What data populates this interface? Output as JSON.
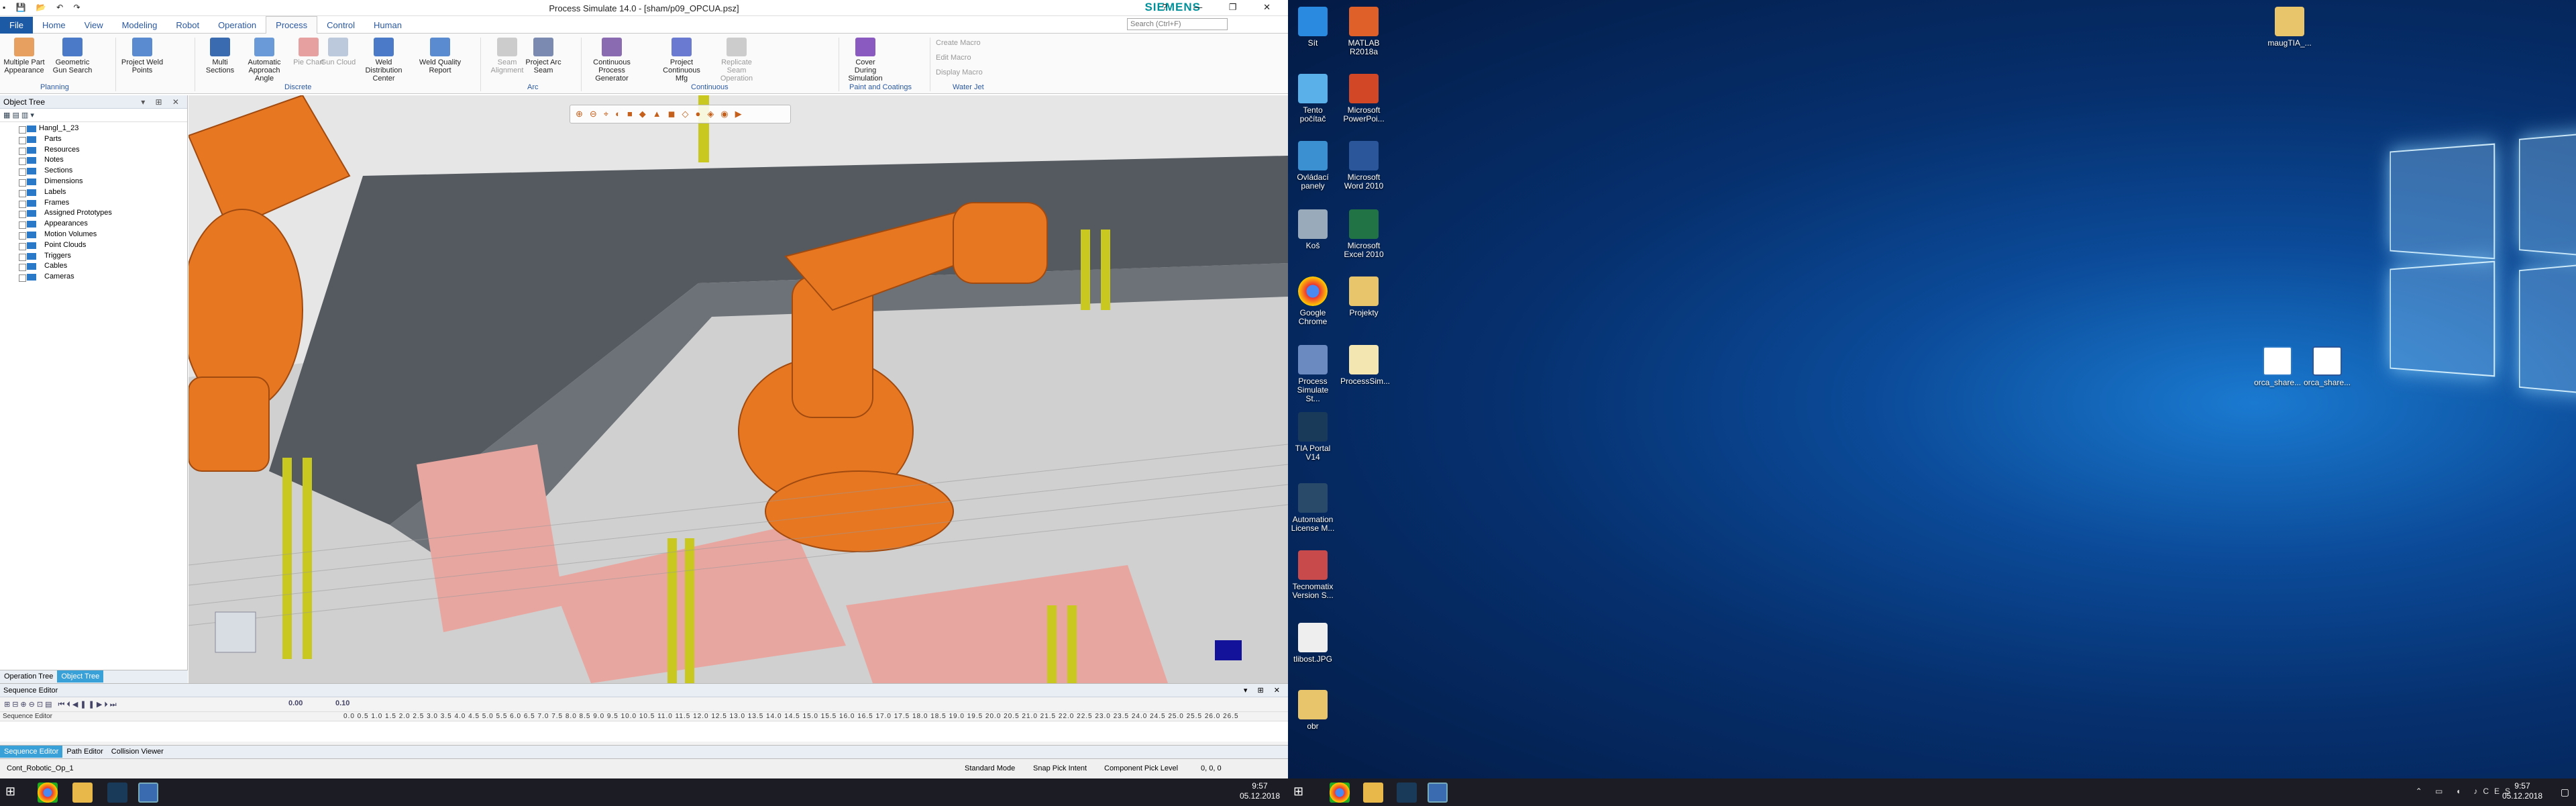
{
  "app": {
    "window_title": "Process Simulate 14.0 - [sham/p09_OPCUA.psz]",
    "brand": "SIEMENS",
    "search_placeholder": "Search (Ctrl+F)",
    "tabs": [
      "File",
      "Home",
      "View",
      "Modeling",
      "Robot",
      "Operation",
      "Process",
      "Control",
      "Human"
    ],
    "active_tab": "Process"
  },
  "ribbon": {
    "buttons": [
      {
        "label": "Multiple Part Appearance",
        "disabled": false
      },
      {
        "label": "Geometric Gun Search",
        "disabled": false
      },
      {
        "label": "Project Weld Points",
        "disabled": false
      },
      {
        "label": "Multi Sections",
        "disabled": false
      },
      {
        "label": "Automatic Approach Angle",
        "disabled": false
      },
      {
        "label": "Pie Chart",
        "disabled": true
      },
      {
        "label": "Gun Cloud",
        "disabled": true
      },
      {
        "label": "Weld Distribution Center",
        "disabled": false
      },
      {
        "label": "Weld Quality Report",
        "disabled": false
      },
      {
        "label": "Seam Alignment",
        "disabled": true
      },
      {
        "label": "Project Arc Seam",
        "disabled": false
      },
      {
        "label": "Continuous Process Generator",
        "disabled": false
      },
      {
        "label": "Project Continuous Mfg",
        "disabled": false
      },
      {
        "label": "Replicate Seam Operation",
        "disabled": true
      },
      {
        "label": "Cover During Simulation",
        "disabled": false
      }
    ],
    "groups": [
      "Planning",
      "Discrete",
      "Arc",
      "Continuous",
      "Paint and Coatings",
      "Water Jet"
    ],
    "macros": [
      "Create Macro",
      "Edit Macro",
      "Display Macro"
    ]
  },
  "object_tree": {
    "title": "Object Tree",
    "root": "Hangl_1_23",
    "items": [
      "Parts",
      "Resources",
      "Notes",
      "Sections",
      "Dimensions",
      "Labels",
      "Frames",
      "Assigned Prototypes",
      "Appearances",
      "Motion Volumes",
      "Point Clouds",
      "Triggers",
      "Cables",
      "Cameras"
    ],
    "tabs": [
      "Operation Tree",
      "Object Tree"
    ]
  },
  "sequence_editor": {
    "title": "Sequence Editor",
    "time_value": "0.00",
    "step_value": "0.10",
    "row_label": "Sequence Editor",
    "ruler_ticks": "0.0 0.5 1.0 1.5 2.0 2.5 3.0 3.5 4.0 4.5 5.0 5.5 6.0 6.5 7.0 7.5 8.0 8.5 9.0 9.5 10.0 10.5 11.0 11.5 12.0 12.5 13.0 13.5 14.0 14.5 15.0 15.5 16.0 16.5 17.0 17.5 18.0 18.5 19.0 19.5 20.0 20.5 21.0 21.5 22.0 22.5 23.0 23.5 24.0 24.5 25.0 25.5 26.0 26.5",
    "tabs": [
      "Sequence Editor",
      "Path Editor",
      "Collision Viewer"
    ]
  },
  "status_bar": {
    "operation": "Cont_Robotic_Op_1",
    "mode": "Standard Mode",
    "pick_intent": "Snap Pick Intent",
    "pick_level": "Component Pick Level",
    "coords": "0, 0, 0"
  },
  "taskbar": {
    "time": "9:57",
    "date": "05.12.2018",
    "lang": "CES"
  },
  "desktop_icons": [
    "Sít",
    "MATLAB R2018a",
    "Tento počítač",
    "Microsoft PowerPoi...",
    "Ovládací panely",
    "Microsoft Word 2010",
    "Koš",
    "Microsoft Excel 2010",
    "Google Chrome",
    "Projekty",
    "Process Simulate St...",
    "ProcessSim...",
    "TIA Portal V14",
    "Automation License M...",
    "Tecnomatix Version S...",
    "tlibost.JPG",
    "obr",
    "maugTIA_...",
    "orca_share...",
    "orca_share..."
  ],
  "colors": {
    "accent": "#1d5aa6",
    "robot": "#e87722",
    "desktop_blue": "#0b4a98"
  }
}
